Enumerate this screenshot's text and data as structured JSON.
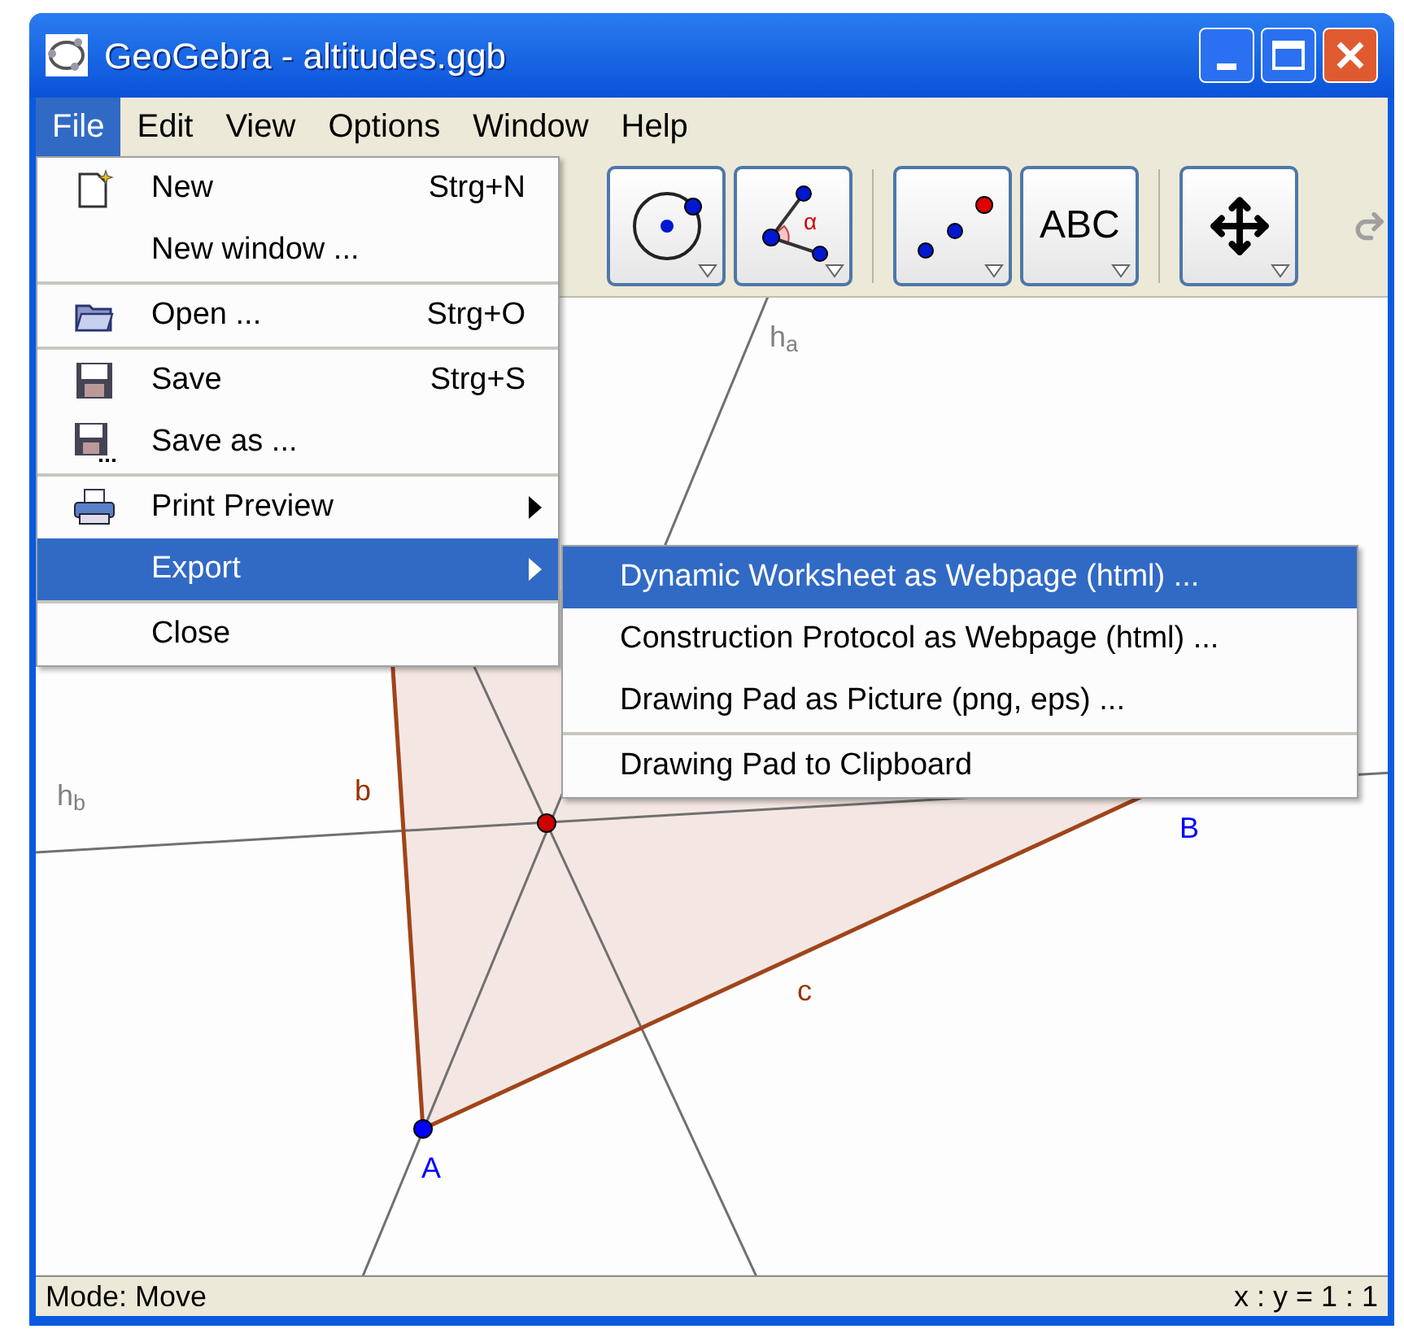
{
  "window": {
    "title": "GeoGebra - altitudes.ggb"
  },
  "menu_bar": [
    {
      "label": "File",
      "selected": true
    },
    {
      "label": "Edit",
      "selected": false
    },
    {
      "label": "View",
      "selected": false
    },
    {
      "label": "Options",
      "selected": false
    },
    {
      "label": "Window",
      "selected": false
    },
    {
      "label": "Help",
      "selected": false
    }
  ],
  "toolbar": {
    "tools": [
      {
        "kind": "circle"
      },
      {
        "kind": "angle",
        "symbol": "α"
      },
      {
        "kind": "points"
      },
      {
        "kind": "text",
        "label": "ABC"
      },
      {
        "kind": "move"
      }
    ]
  },
  "file_menu": {
    "groups": [
      [
        {
          "label": "New",
          "shortcut": "Strg+N",
          "selected": false
        },
        {
          "label": "New window ...",
          "selected": false
        }
      ],
      [
        {
          "label": "Open ...",
          "shortcut": "Strg+O",
          "selected": false
        }
      ],
      [
        {
          "label": "Save",
          "shortcut": "Strg+S",
          "selected": false
        },
        {
          "label": "Save as ...",
          "selected": false
        }
      ],
      [
        {
          "label": "Print Preview",
          "has_submenu": true,
          "selected": false
        },
        {
          "label": "Export",
          "has_submenu": true,
          "selected": true
        }
      ],
      [
        {
          "label": "Close",
          "selected": false
        }
      ]
    ]
  },
  "export_submenu": {
    "groups": [
      [
        {
          "label": "Dynamic Worksheet as Webpage (html) ...",
          "selected": true
        },
        {
          "label": "Construction Protocol as Webpage (html) ...",
          "selected": false
        },
        {
          "label": "Drawing Pad as Picture (png, eps) ...",
          "selected": false
        }
      ],
      [
        {
          "label": "Drawing Pad to Clipboard",
          "selected": false
        }
      ]
    ]
  },
  "canvas": {
    "labels": [
      {
        "text": "h$_{a}$",
        "color": "#808080"
      },
      {
        "text": "h$_{b}$",
        "color": "#808080"
      },
      {
        "text": "b",
        "color": "#993300"
      },
      {
        "text": "c",
        "color": "#993300"
      },
      {
        "text": "B",
        "color": "#0000ff"
      },
      {
        "text": "A",
        "color": "#0000ff"
      }
    ],
    "points": [
      {
        "color": "#0000ff"
      },
      {
        "color": "#cc0000"
      }
    ]
  },
  "status_bar": {
    "mode": "Mode: Move",
    "scale": "x : y = 1 : 1"
  }
}
